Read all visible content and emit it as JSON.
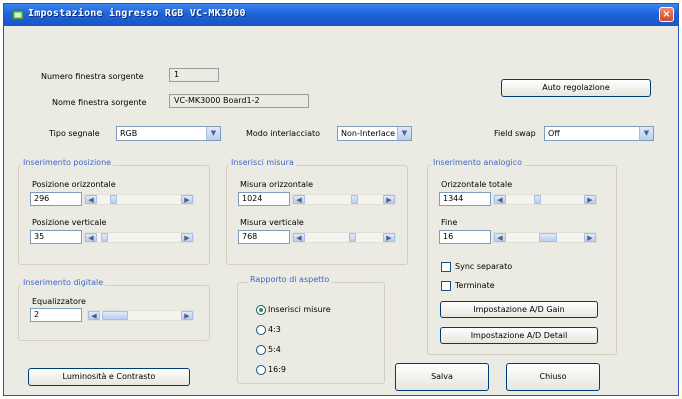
{
  "window": {
    "title": "Impostazione ingresso RGB VC-MK3000",
    "close_glyph": "×"
  },
  "source": {
    "window_number_label": "Numero finestra sorgente",
    "window_number_value": "1",
    "window_name_label": "Nome finestra sorgente",
    "window_name_value": "VC-MK3000 Board1-2"
  },
  "auto_adjust_button": "Auto regolazione",
  "signal": {
    "signal_type_label": "Tipo segnale",
    "signal_type_value": "RGB",
    "interlace_label": "Modo interlacciato",
    "interlace_value": "Non-Interlace",
    "field_swap_label": "Field swap",
    "field_swap_value": "Off"
  },
  "position_group": {
    "title": "Inserimento posizione",
    "horizontal_label": "Posizione orizzontale",
    "horizontal_value": "296",
    "vertical_label": "Posizione verticale",
    "vertical_value": "35"
  },
  "size_group": {
    "title": "Inserisci misura",
    "horizontal_label": "Misura orizzontale",
    "horizontal_value": "1024",
    "vertical_label": "Misura verticale",
    "vertical_value": "768"
  },
  "analog_group": {
    "title": "Inserimento analogico",
    "total_horizontal_label": "Orizzontale totale",
    "total_horizontal_value": "1344",
    "fine_label": "Fine",
    "fine_value": "16",
    "sync_separate_label": "Sync separato",
    "terminate_label": "Terminate",
    "ad_gain_button": "Impostazione A/D Gain",
    "ad_detail_button": "Impostazione A/D Detail"
  },
  "digital_group": {
    "title": "Inserimento digitale",
    "equalizer_label": "Equalizzatore",
    "equalizer_value": "2"
  },
  "aspect_group": {
    "title": "Rapporto di aspetto",
    "options": [
      "Inserisci misure",
      "4:3",
      "5:4",
      "16:9"
    ],
    "selected": "Inserisci misure"
  },
  "buttons": {
    "brightness_contrast": "Luminosità e Contrasto",
    "save": "Salva",
    "close": "Chiuso"
  },
  "glyphs": {
    "left": "◀",
    "right": "▶",
    "down": "▼"
  },
  "accent_colors": {
    "group_title": "#3f66c4",
    "titlebar": "#1f63d8",
    "close": "#d1462a"
  }
}
